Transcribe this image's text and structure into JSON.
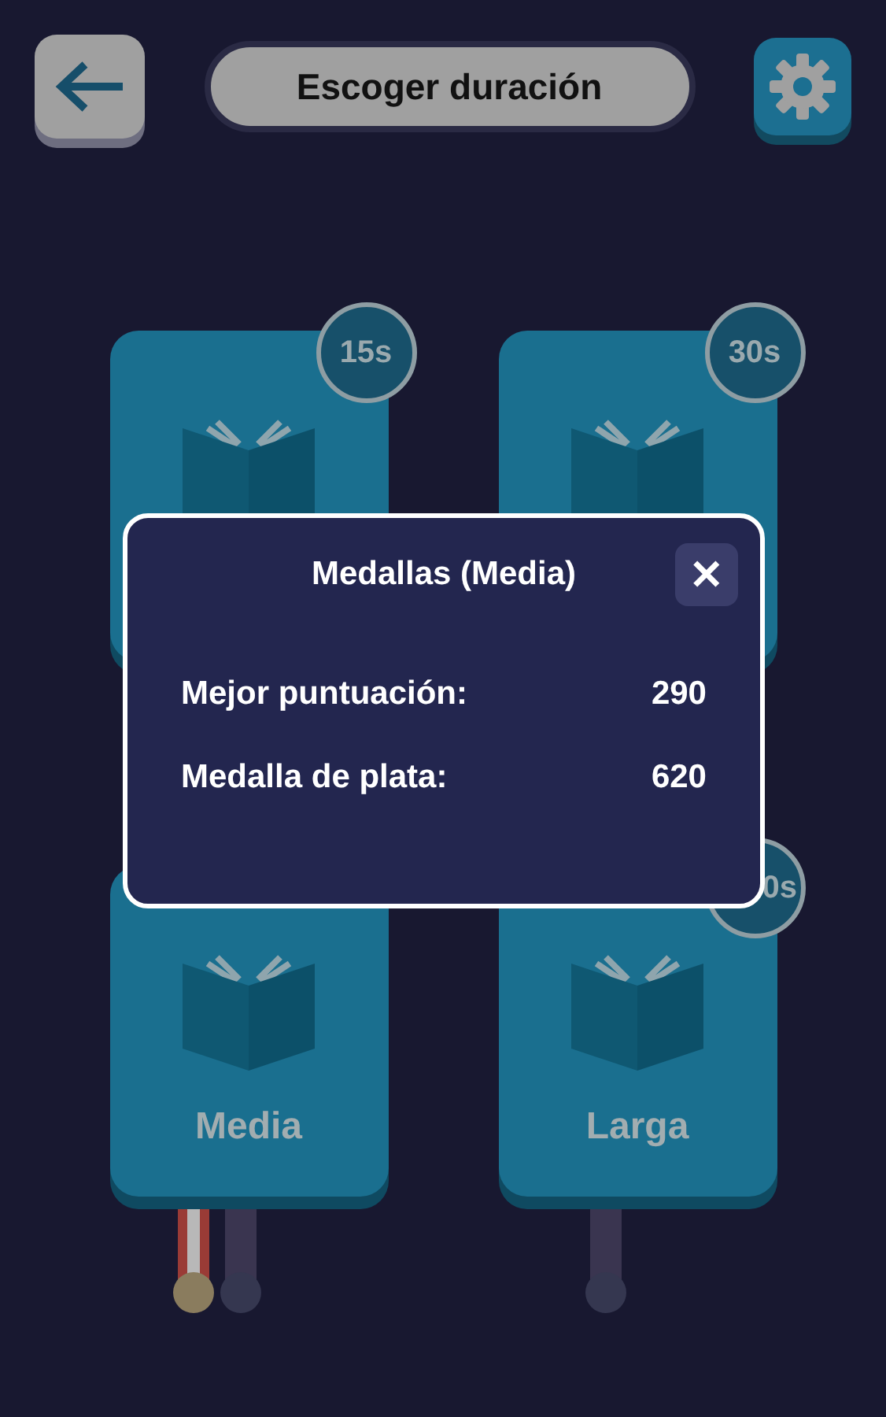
{
  "header": {
    "title": "Escoger duración"
  },
  "cards": [
    {
      "badge": "15s",
      "badge_cut": false
    },
    {
      "badge": "30s",
      "badge_cut": false
    },
    {
      "label": "Media",
      "medals": [
        {
          "earned": true
        },
        {
          "earned": false
        }
      ]
    },
    {
      "badge": "0s",
      "badge_cut": true,
      "label": "Larga",
      "medals": [
        {
          "earned": false
        }
      ]
    }
  ],
  "dialog": {
    "title": "Medallas (Media)",
    "close": "✕",
    "rows": [
      {
        "label": "Mejor puntuación:",
        "value": "290"
      },
      {
        "label": "Medalla de plata:",
        "value": "620"
      }
    ]
  }
}
